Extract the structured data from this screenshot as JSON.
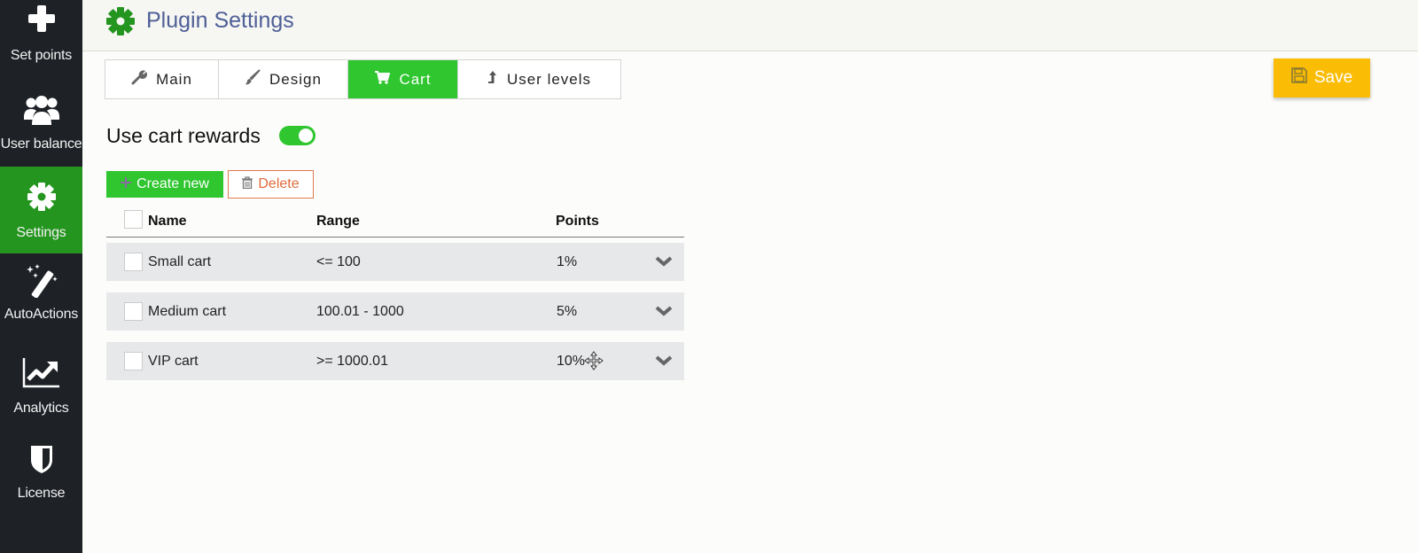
{
  "sidebar": {
    "items": [
      {
        "label": "Set points",
        "icon": "plus-icon",
        "active": false
      },
      {
        "label": "User balance",
        "icon": "users-icon",
        "active": false
      },
      {
        "label": "Settings",
        "icon": "gear-icon",
        "active": true
      },
      {
        "label": "AutoActions",
        "icon": "magic-wand-icon",
        "active": false
      },
      {
        "label": "Analytics",
        "icon": "chart-line-icon",
        "active": false
      },
      {
        "label": "License",
        "icon": "shield-icon",
        "active": false
      }
    ]
  },
  "header": {
    "title": "Plugin Settings",
    "icon": "gear-icon"
  },
  "tabs": [
    {
      "label": "Main",
      "icon": "wrench-icon",
      "active": false
    },
    {
      "label": "Design",
      "icon": "paintbrush-icon",
      "active": false
    },
    {
      "label": "Cart",
      "icon": "cart-icon",
      "active": true
    },
    {
      "label": "User levels",
      "icon": "level-up-icon",
      "active": false
    }
  ],
  "toolbar": {
    "save_label": "Save"
  },
  "cart": {
    "use_label": "Use cart rewards",
    "enabled": true,
    "create_label": "Create new",
    "delete_label": "Delete",
    "columns": {
      "name": "Name",
      "range": "Range",
      "points": "Points"
    },
    "rows": [
      {
        "name": "Small cart",
        "range": "<= 100",
        "points": "1%"
      },
      {
        "name": "Medium cart",
        "range": "100.01 - 1000",
        "points": "5%"
      },
      {
        "name": "VIP cart",
        "range": ">= 1000.01",
        "points": "10%"
      }
    ]
  },
  "colors": {
    "accent_green": "#2fc62f",
    "sidebar_active": "#24951f",
    "save_yellow": "#fbbc05",
    "delete_orange": "#df6a3a",
    "title_blue": "#4e5f96"
  }
}
